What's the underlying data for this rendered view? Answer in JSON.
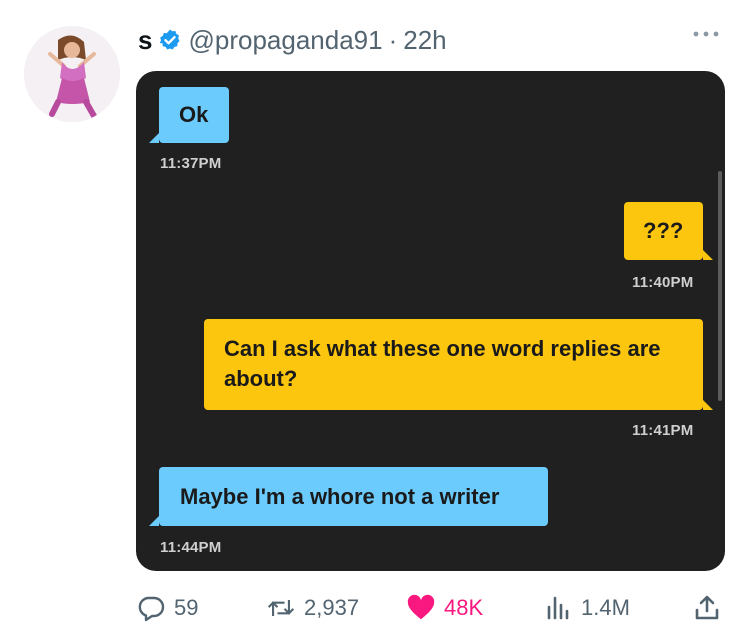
{
  "tweet": {
    "display_name": "s",
    "handle": "@propaganda91",
    "separator": "·",
    "time": "22h"
  },
  "chat": {
    "messages": [
      {
        "side": "left",
        "text": "Ok",
        "time": "11:37PM"
      },
      {
        "side": "right",
        "text": "???",
        "time": "11:40PM"
      },
      {
        "side": "right",
        "text": "Can I ask what these one word replies are about?",
        "time": "11:41PM"
      },
      {
        "side": "left",
        "text": "Maybe I'm a whore not a writer",
        "time": "11:44PM"
      }
    ]
  },
  "actions": {
    "replies": "59",
    "retweets": "2,937",
    "likes": "48K",
    "views": "1.4M"
  },
  "colors": {
    "chat_background": "#202020",
    "bubble_blue": "#6bcbfd",
    "bubble_yellow": "#fcc60f",
    "like_pink": "#f91880",
    "verified_blue": "#1d9bf0"
  },
  "icons": [
    "verified-badge-icon",
    "more-options-icon",
    "reply-icon",
    "retweet-icon",
    "heart-icon",
    "views-icon",
    "share-icon"
  ]
}
